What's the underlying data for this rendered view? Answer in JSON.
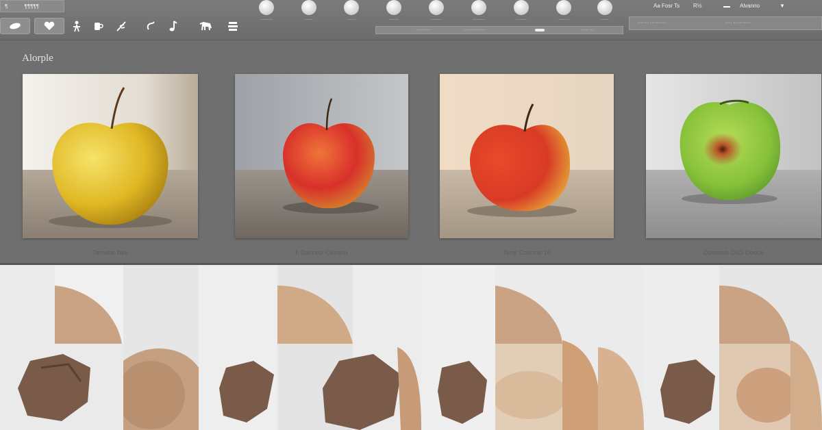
{
  "window": {
    "title_left": "¶",
    "title_right": "¶¶¶¶¶"
  },
  "toolbar": {
    "tools": [
      {
        "icon": "leaf-icon"
      },
      {
        "icon": "heart-icon"
      },
      {
        "icon": "figure-icon"
      },
      {
        "icon": "mug-icon"
      },
      {
        "icon": "feather-icon"
      },
      {
        "icon": "hook-icon"
      },
      {
        "icon": "note-icon"
      },
      {
        "icon": "animal-icon"
      },
      {
        "icon": "stack-icon"
      }
    ],
    "thumbs": [
      {
        "label": "·········"
      },
      {
        "label": "······"
      },
      {
        "label": "······"
      },
      {
        "label": "·······"
      },
      {
        "label": "········"
      },
      {
        "label": "·········"
      },
      {
        "label": "········"
      },
      {
        "label": "········"
      },
      {
        "label": "······"
      }
    ],
    "sub_bar": {
      "left_text": "···· ······",
      "mid_text": "····· ··········",
      "right_text": "····· ···"
    }
  },
  "right_panel": {
    "label_a": "Aa Fosr Ts",
    "label_b": "R½",
    "label_c": "Alvanno",
    "box_left": "······· ··········",
    "box_right": "···· ···········"
  },
  "gallery": {
    "label": "Alorple",
    "cards": [
      {
        "caption": "Tarnabc bee",
        "apple_color": "#e0b824",
        "bg": "#d9d2c8"
      },
      {
        "caption": "Il Dasces/ Ceeshn",
        "apple_color": "#d8302a",
        "bg": "#a9abaf"
      },
      {
        "caption": "Tarty Ccecsie 10",
        "apple_color": "#d83a26",
        "bg": "#e8d4bf"
      },
      {
        "caption": "Dsosenh DICI Dooce",
        "apple_color": "#86c13a",
        "bg": "#cfcfcf"
      }
    ]
  },
  "colors": {
    "app_bg": "#6f6f6f",
    "toolbar_bg": "#7a7a7a",
    "filmstrip_bg": "#e9e9e9",
    "rock": "#7a5a48",
    "skin": "#c9a383"
  }
}
